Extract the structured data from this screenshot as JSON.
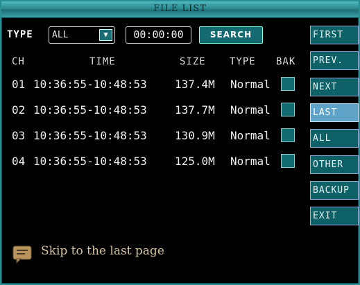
{
  "window": {
    "title": "FILE LIST"
  },
  "filter": {
    "type_label": "TYPE",
    "type_value": "ALL",
    "time_value": "00:00:00",
    "search_label": "SEARCH"
  },
  "columns": {
    "ch": "CH",
    "time": "TIME",
    "size": "SIZE",
    "type": "TYPE",
    "bak": "BAK"
  },
  "files": [
    {
      "ch": "01",
      "time": "10:36:55-10:48:53",
      "size": "137.4M",
      "type": "Normal"
    },
    {
      "ch": "02",
      "time": "10:36:55-10:48:53",
      "size": "137.7M",
      "type": "Normal"
    },
    {
      "ch": "03",
      "time": "10:36:55-10:48:53",
      "size": "130.9M",
      "type": "Normal"
    },
    {
      "ch": "04",
      "time": "10:36:55-10:48:53",
      "size": "125.0M",
      "type": "Normal"
    }
  ],
  "sidebar": {
    "buttons": [
      {
        "label": "FIRST"
      },
      {
        "label": "PREV."
      },
      {
        "label": "NEXT"
      },
      {
        "label": "LAST"
      },
      {
        "label": "ALL"
      },
      {
        "label": "OTHER"
      },
      {
        "label": "BACKUP"
      },
      {
        "label": "EXIT"
      }
    ]
  },
  "hint": {
    "text": "Skip to the last page",
    "icon": "speech-bubble-icon"
  },
  "colors": {
    "accent": "#146a70",
    "selected": "#5fa4c8",
    "titlebar": "#2d8a91",
    "hint_text": "#d6c49a"
  }
}
